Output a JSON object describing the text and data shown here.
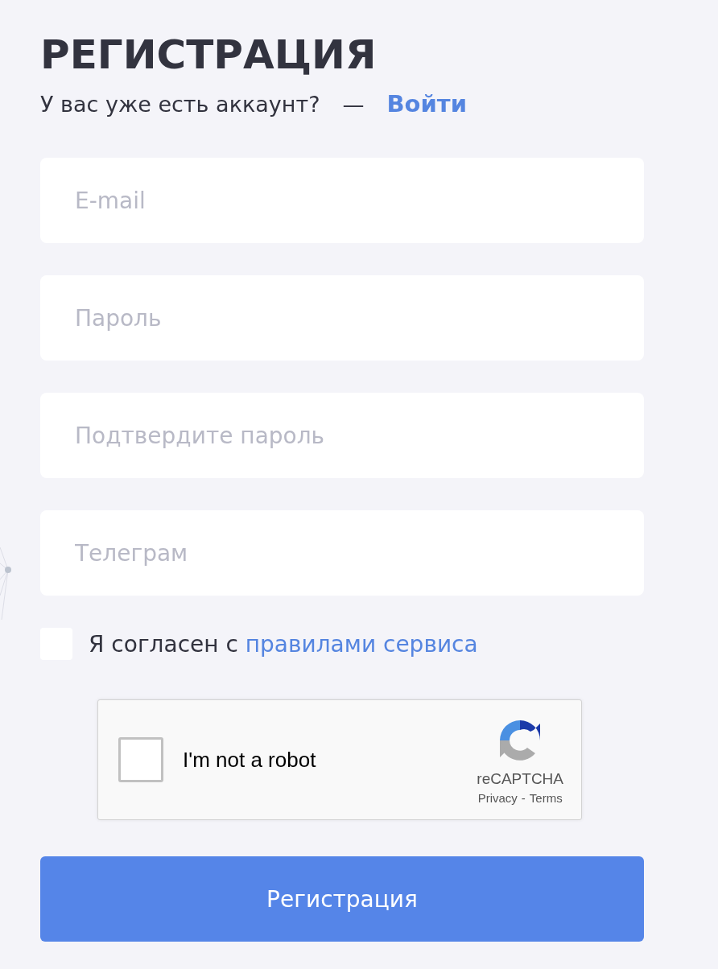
{
  "title": "РЕГИСТРАЦИЯ",
  "subtitle": {
    "text": "У вас уже есть аккаунт?",
    "dash": "—",
    "link": "Войти"
  },
  "fields": [
    {
      "placeholder": "E-mail"
    },
    {
      "placeholder": "Пароль"
    },
    {
      "placeholder": "Подтвердите пароль"
    },
    {
      "placeholder": "Телеграм"
    }
  ],
  "agreement": {
    "checked": false,
    "text": "Я согласен с",
    "link": "правилами сервиса"
  },
  "captcha": {
    "checked": false,
    "label": "I'm not a robot",
    "brand": "reCAPTCHA",
    "privacy": "Privacy",
    "separator": "-",
    "terms": "Terms"
  },
  "submit": "Регистрация"
}
